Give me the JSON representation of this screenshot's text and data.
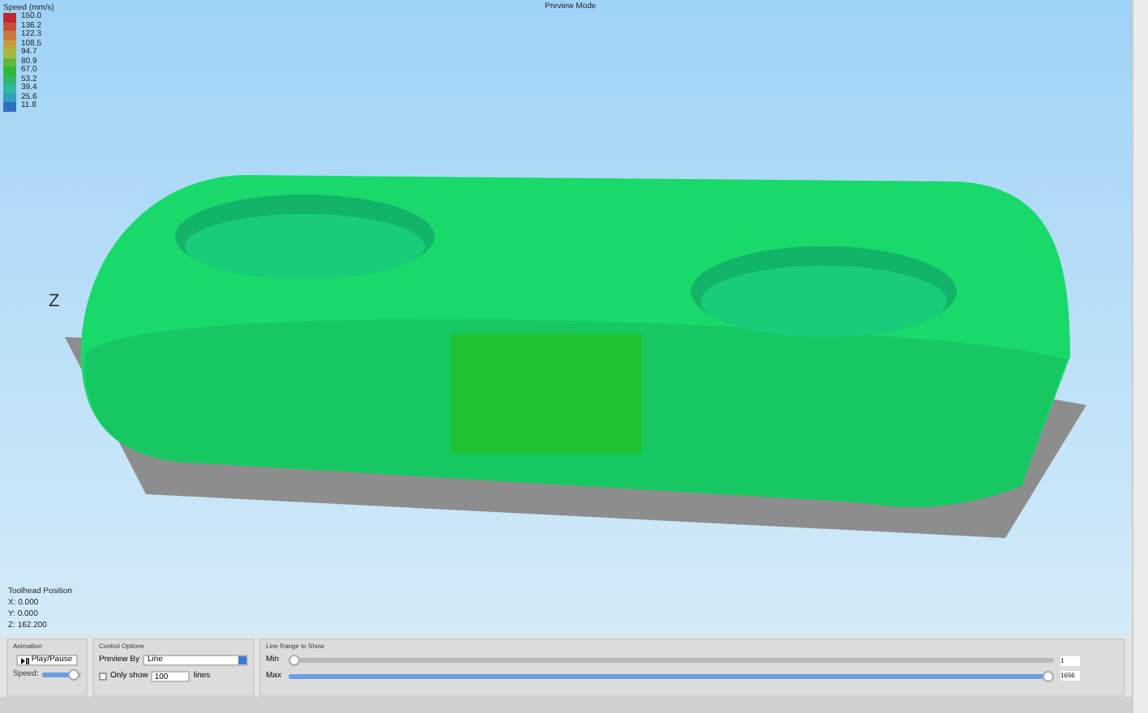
{
  "viewport": {
    "title": "Preview Mode",
    "axis_label": "Z"
  },
  "legend": {
    "title": "Speed (mm/s)",
    "entries": [
      {
        "label": "150.0",
        "color": "#c0282d"
      },
      {
        "label": "136.2",
        "color": "#c8503a"
      },
      {
        "label": "122.3",
        "color": "#c97a3a"
      },
      {
        "label": "108.5",
        "color": "#c4a03a"
      },
      {
        "label": "94.7",
        "color": "#a8b83a"
      },
      {
        "label": "80.9",
        "color": "#5fb83a"
      },
      {
        "label": "67.0",
        "color": "#2fb83a"
      },
      {
        "label": "53.2",
        "color": "#2fb86a"
      },
      {
        "label": "39.4",
        "color": "#2fb8a0"
      },
      {
        "label": "25.6",
        "color": "#2f9ec0"
      },
      {
        "label": "11.8",
        "color": "#2f6ec8"
      }
    ]
  },
  "toolhead": {
    "title": "Toolhead Position",
    "lines": [
      "X: 0.000",
      "Y: 0.000",
      "Z: 162.200"
    ]
  },
  "animation": {
    "title": "Animation",
    "button": "Play/Pause",
    "speed_label": "Speed:",
    "level": 0.95
  },
  "control_options": {
    "title": "Control Options",
    "preview_by_label": "Preview By",
    "preview_by_value": "Line",
    "only_show": {
      "label": "Only show",
      "checked": false,
      "value": "100",
      "unit": "lines"
    }
  },
  "line_range": {
    "title": "Line Range to Show",
    "min": {
      "label": "Min",
      "level": 0.0,
      "value": "1"
    },
    "max": {
      "label": "Max",
      "level": 1.0,
      "value": "1656"
    }
  }
}
